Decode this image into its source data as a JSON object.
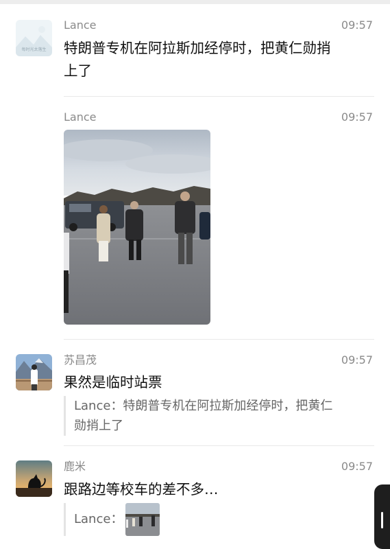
{
  "messages": [
    {
      "sender": "Lance",
      "time": "09:57",
      "text_lines": [
        "特朗普专机在阿拉斯加经停时，把黄仁勋捎",
        "上了"
      ],
      "avatar_caption": "每时光太落生"
    },
    {
      "sender": "Lance",
      "time": "09:57",
      "image_icon": "photo-icon"
    },
    {
      "sender": "苏昌茂",
      "time": "09:57",
      "text": "果然是临时站票",
      "quote_lines": [
        "Lance：特朗普专机在阿拉斯加经停时，把黄仁",
        "勋捎上了"
      ]
    },
    {
      "sender": "鹿米",
      "time": "09:57",
      "text": "跟路边等校车的差不多…",
      "quote_prefix": "Lance："
    }
  ],
  "colors": {
    "background": "#ffffff",
    "meta_text": "#8a8a8a",
    "message_text": "#111111",
    "quote_text": "#666666",
    "divider": "#e9e9e9"
  }
}
